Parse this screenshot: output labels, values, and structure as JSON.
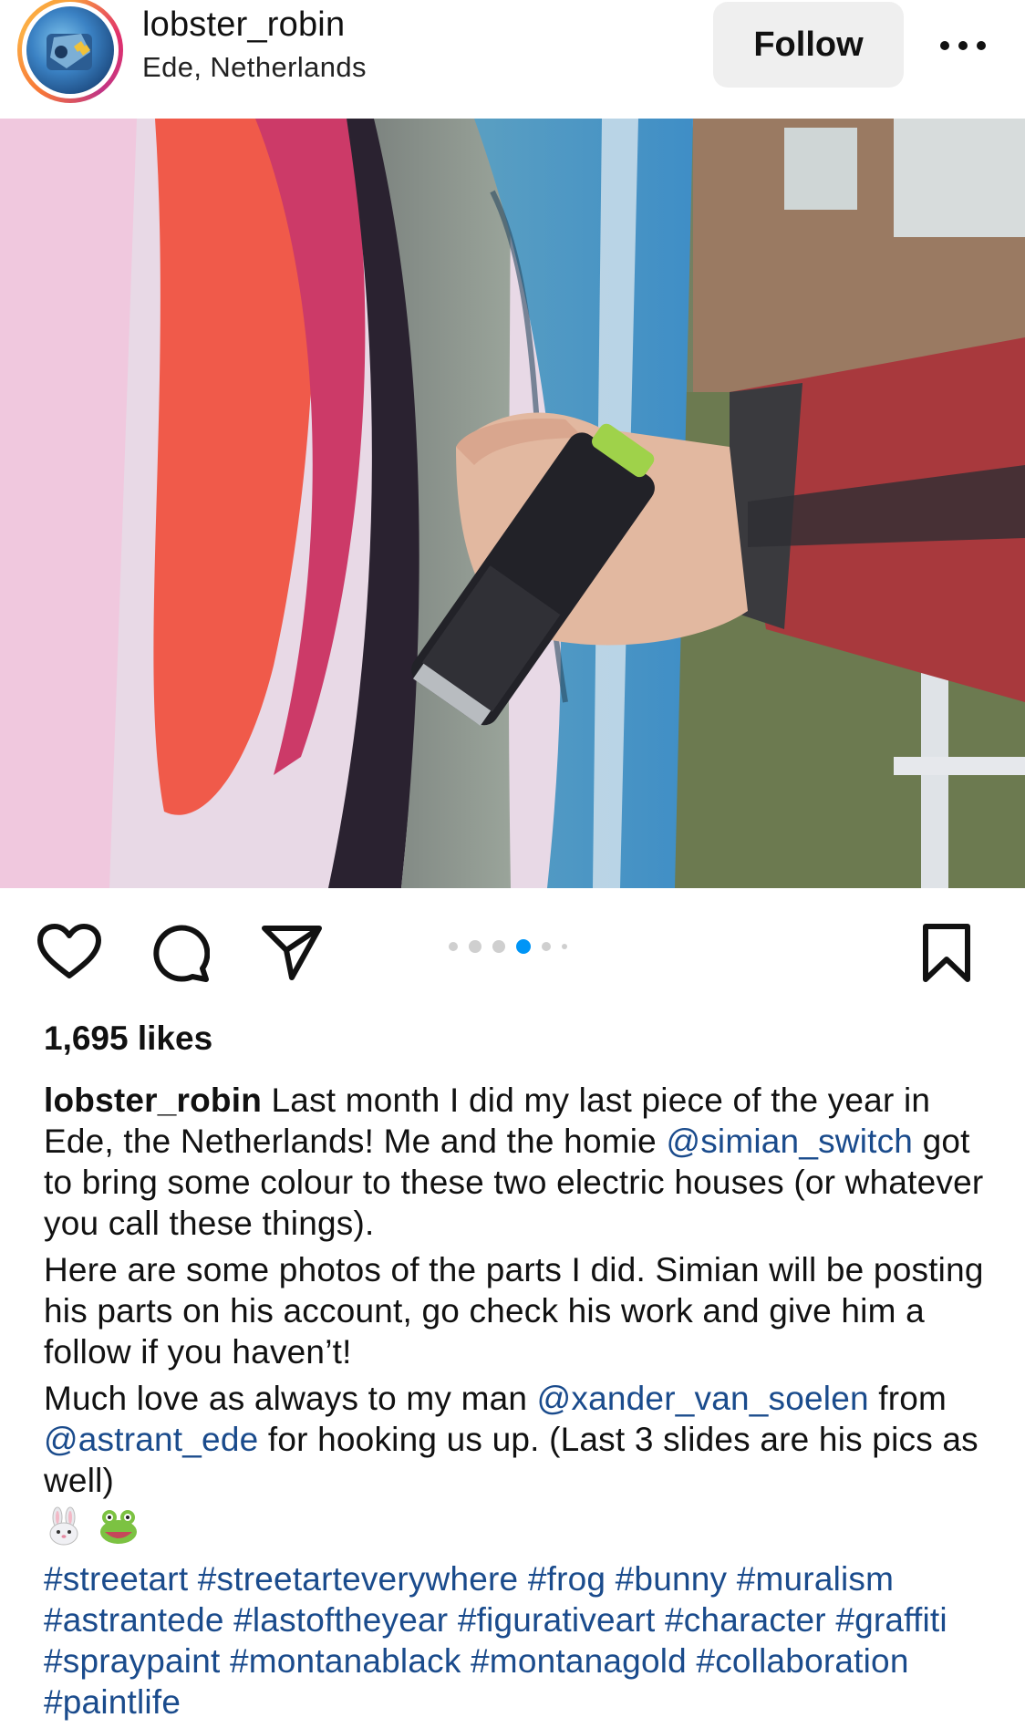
{
  "post": {
    "username": "lobster_robin",
    "location": "Ede, Netherlands",
    "follow_label": "Follow",
    "likes": "1,695 likes",
    "carousel": {
      "total": 6,
      "active_index": 3
    },
    "caption": {
      "p1_before": "Last month I did my last piece of the year in Ede, the Netherlands! Me and the homie ",
      "mention1": "@simian_switch",
      "p1_after": " got to bring some colour to these two electric houses (or whatever you call these things).",
      "p2": "Here are some photos of the parts I did. Simian will be posting his parts on his account, go check his work and give him a follow if you haven’t!",
      "p3_before": "Much love as always to my man ",
      "mention2": "@xander_van_soelen",
      "p3_mid": " from ",
      "mention3": "@astrant_ede",
      "p3_after": " for hooking us up. (Last 3 slides are his pics as well)",
      "emojis": [
        "rabbit-face-emoji",
        "frog-face-emoji"
      ],
      "hashtags": [
        "#streetart",
        "#streetarteverywhere",
        "#frog",
        "#bunny",
        "#muralism",
        "#astrantede",
        "#lastoftheyear",
        "#figurativeart",
        "#character",
        "#graffiti",
        "#spraypaint",
        "#montanablack",
        "#montanagold",
        "#collaboration",
        "#paintlife"
      ]
    }
  },
  "colors": {
    "link": "#1a4b8c",
    "carousel_active": "#0095f6",
    "follow_bg": "#efefef"
  },
  "icons": [
    "more-options-icon",
    "heart-icon",
    "comment-icon",
    "share-icon",
    "bookmark-icon"
  ]
}
